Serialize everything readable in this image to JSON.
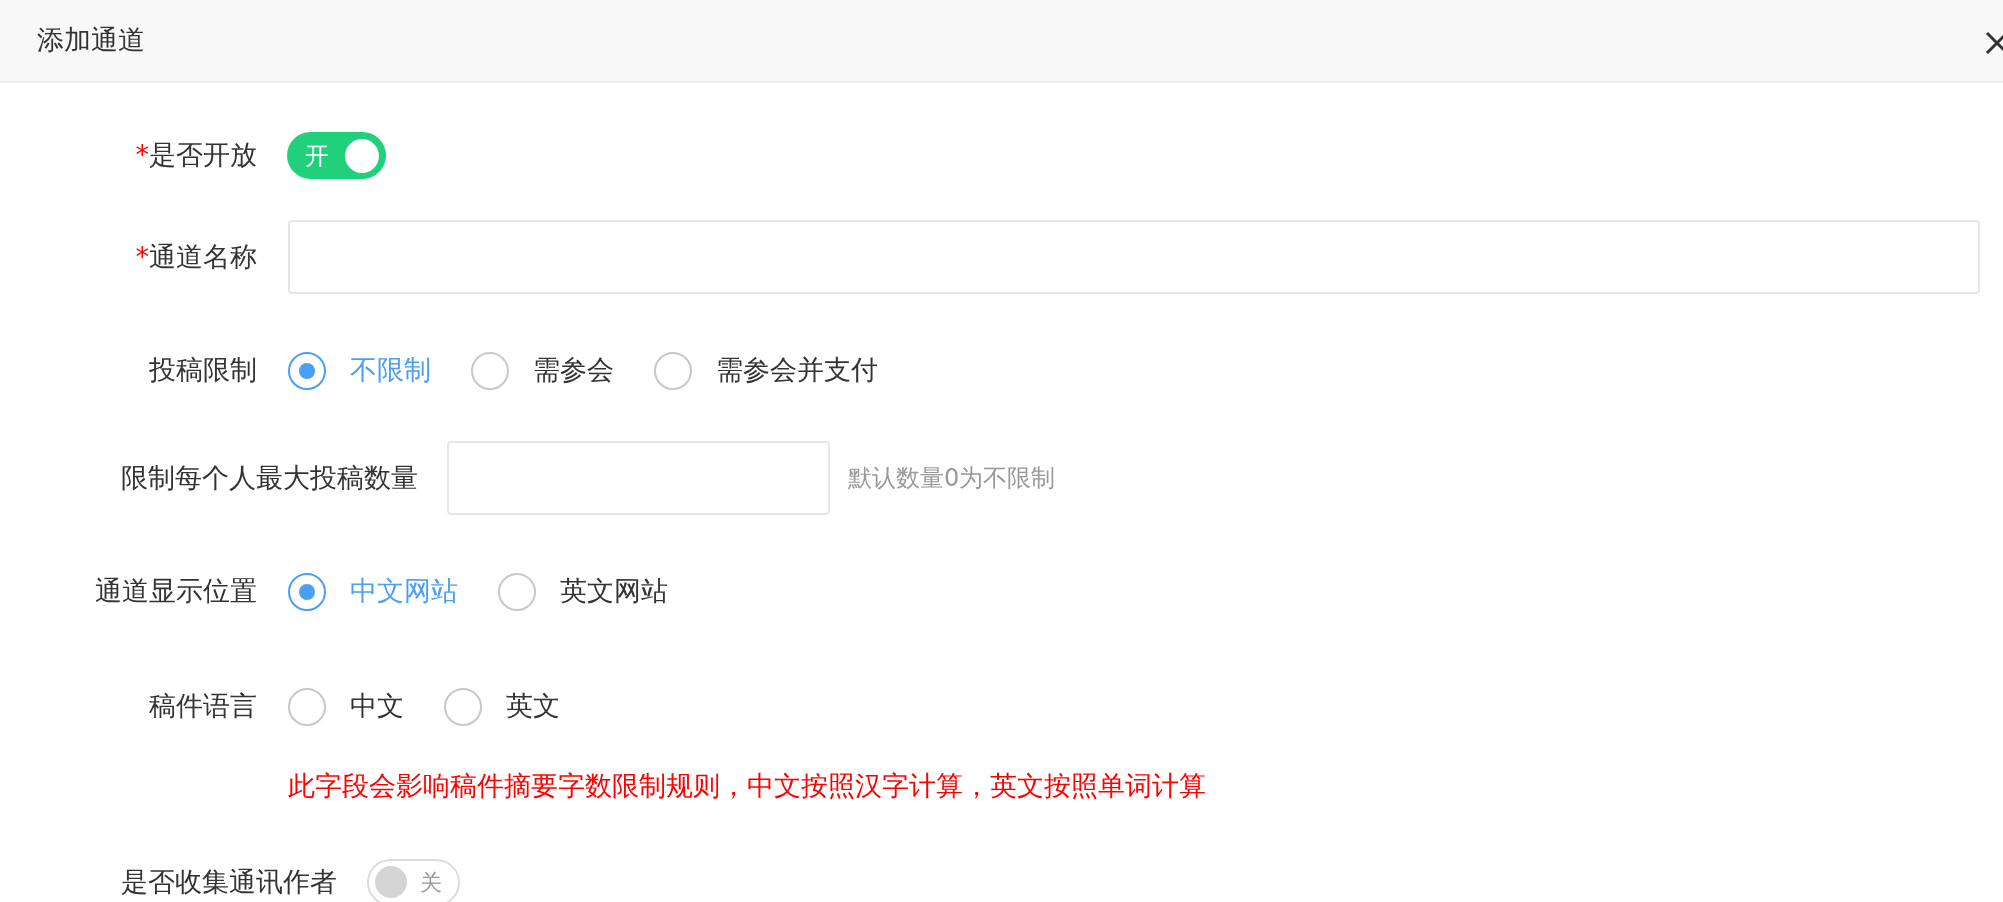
{
  "dialog": {
    "title": "添加通道"
  },
  "fields": [
    {
      "kind": "switch",
      "label": "是否开放",
      "required_mark": "*",
      "on": true,
      "text": "开"
    },
    {
      "kind": "text",
      "label": "通道名称",
      "required_mark": "*"
    },
    {
      "kind": "radio",
      "label": "投稿限制",
      "options": [
        {
          "label": "不限制",
          "selected": true
        },
        {
          "label": "需参会",
          "selected": false
        },
        {
          "label": "需参会并支付",
          "selected": false
        }
      ]
    },
    {
      "kind": "number",
      "label": "限制每个人最大投稿数量",
      "hint": "默认数量0为不限制"
    },
    {
      "kind": "radio",
      "label": "通道显示位置",
      "options": [
        {
          "label": "中文网站",
          "selected": true
        },
        {
          "label": "英文网站",
          "selected": false
        }
      ]
    },
    {
      "kind": "radio",
      "label": "稿件语言",
      "options": [
        {
          "label": "中文",
          "selected": false
        },
        {
          "label": "英文",
          "selected": false
        }
      ],
      "note": "此字段会影响稿件摘要字数限制规则，中文按照汉字计算，英文按照单词计算"
    },
    {
      "kind": "switch",
      "label": "是否收集通讯作者",
      "on": false,
      "text": "关"
    }
  ]
}
